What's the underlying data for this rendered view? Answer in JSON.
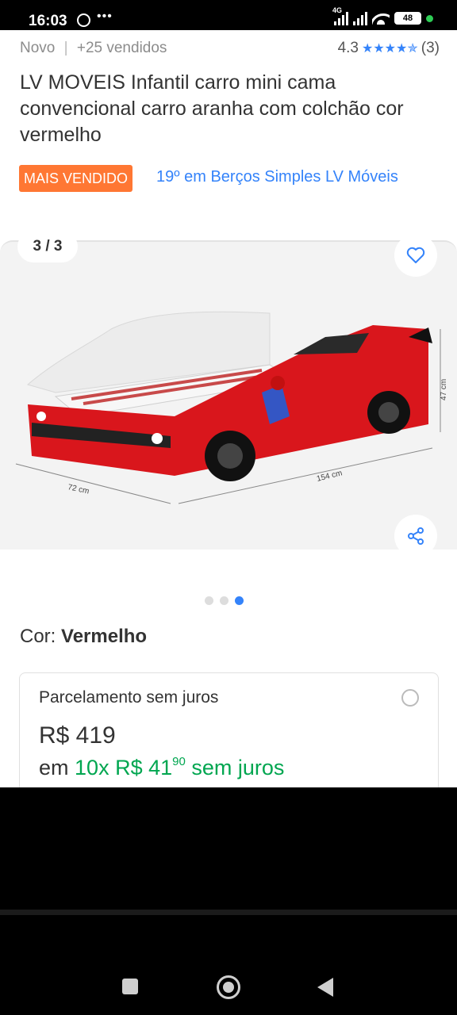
{
  "status_bar": {
    "time": "16:03",
    "network": "4G",
    "battery": "48"
  },
  "product": {
    "condition": "Novo",
    "separator": "|",
    "sold": "+25 vendidos",
    "rating": "4.3",
    "stars": "★★★★✯",
    "reviews": "(3)",
    "title": "LV MOVEIS Infantil carro mini cama convencional carro aranha com colchão cor vermelho",
    "badge": "MAIS VENDIDO",
    "ranking": "19º em Berços Simples LV Móveis"
  },
  "gallery": {
    "counter": "3 / 3",
    "total": 3,
    "active": 3,
    "dims": {
      "width": "72 cm",
      "length": "154 cm",
      "height": "47 cm"
    }
  },
  "color": {
    "label": "Cor:",
    "value": "Vermelho"
  },
  "payment": {
    "title": "Parcelamento sem juros",
    "price": "R$ 419",
    "prefix": "em",
    "installment": "10x R$ 41",
    "cents": "90",
    "suffix": "sem juros"
  },
  "colors": {
    "accent": "#3483fa",
    "badge": "#ff7733",
    "green": "#00a650",
    "car": "#d9161c"
  }
}
